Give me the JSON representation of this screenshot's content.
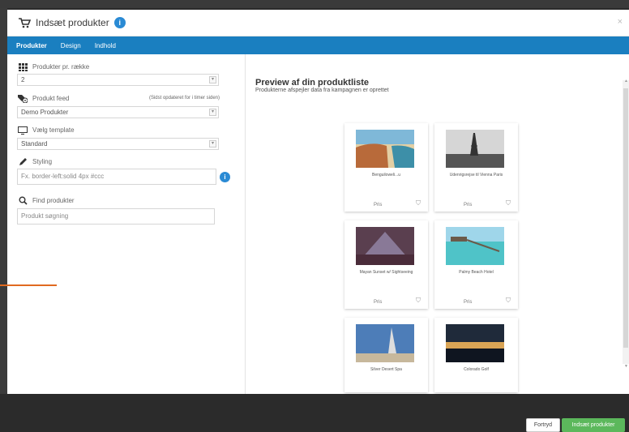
{
  "modal": {
    "title": "Indsæt produkter",
    "badge": "i",
    "close": "×"
  },
  "tabs": [
    {
      "label": "Produkter"
    },
    {
      "label": "Design"
    },
    {
      "label": "Indhold"
    }
  ],
  "form": {
    "per_row_label": "Produkter pr. række",
    "per_row_value": "2",
    "feed_label": "Produkt feed",
    "feed_hint": "(Sidst opdateret for i timer siden)",
    "feed_value": "Demo Produkter",
    "template_label": "Vælg template",
    "template_value": "Standard",
    "styling_label": "Styling",
    "styling_placeholder": "Fx. border-left:solid 4px #ccc",
    "search_label": "Find produkter",
    "search_placeholder": "Produkt søgning"
  },
  "preview": {
    "title": "Preview af din produktliste",
    "subtitle": "Produkterne afspejler data fra kampagnen er oprettet",
    "products": [
      {
        "name": "Benguiloweli...u",
        "price": "Pris",
        "tag_icon": "tag-icon"
      },
      {
        "name": "Udenrigsrejse til Vienna Paris",
        "price": "Pris",
        "tag_icon": "tag-icon"
      },
      {
        "name": "Mayan Sunset w/ Sightseeing",
        "price": "Pris",
        "tag_icon": "tag-icon"
      },
      {
        "name": "Palmy Beach Hotel",
        "price": "Pris",
        "tag_icon": "tag-icon"
      },
      {
        "name": "Silver Desert Spa",
        "price": "",
        "tag_icon": ""
      },
      {
        "name": "Colorado Golf",
        "price": "",
        "tag_icon": ""
      }
    ]
  },
  "footer": {
    "cancel": "Fortryd",
    "insert": "Indsæt produkter"
  },
  "colors": {
    "tab_bar": "#1a7fc0",
    "primary_button": "#5cb85c",
    "info": "#2a8ad4"
  }
}
